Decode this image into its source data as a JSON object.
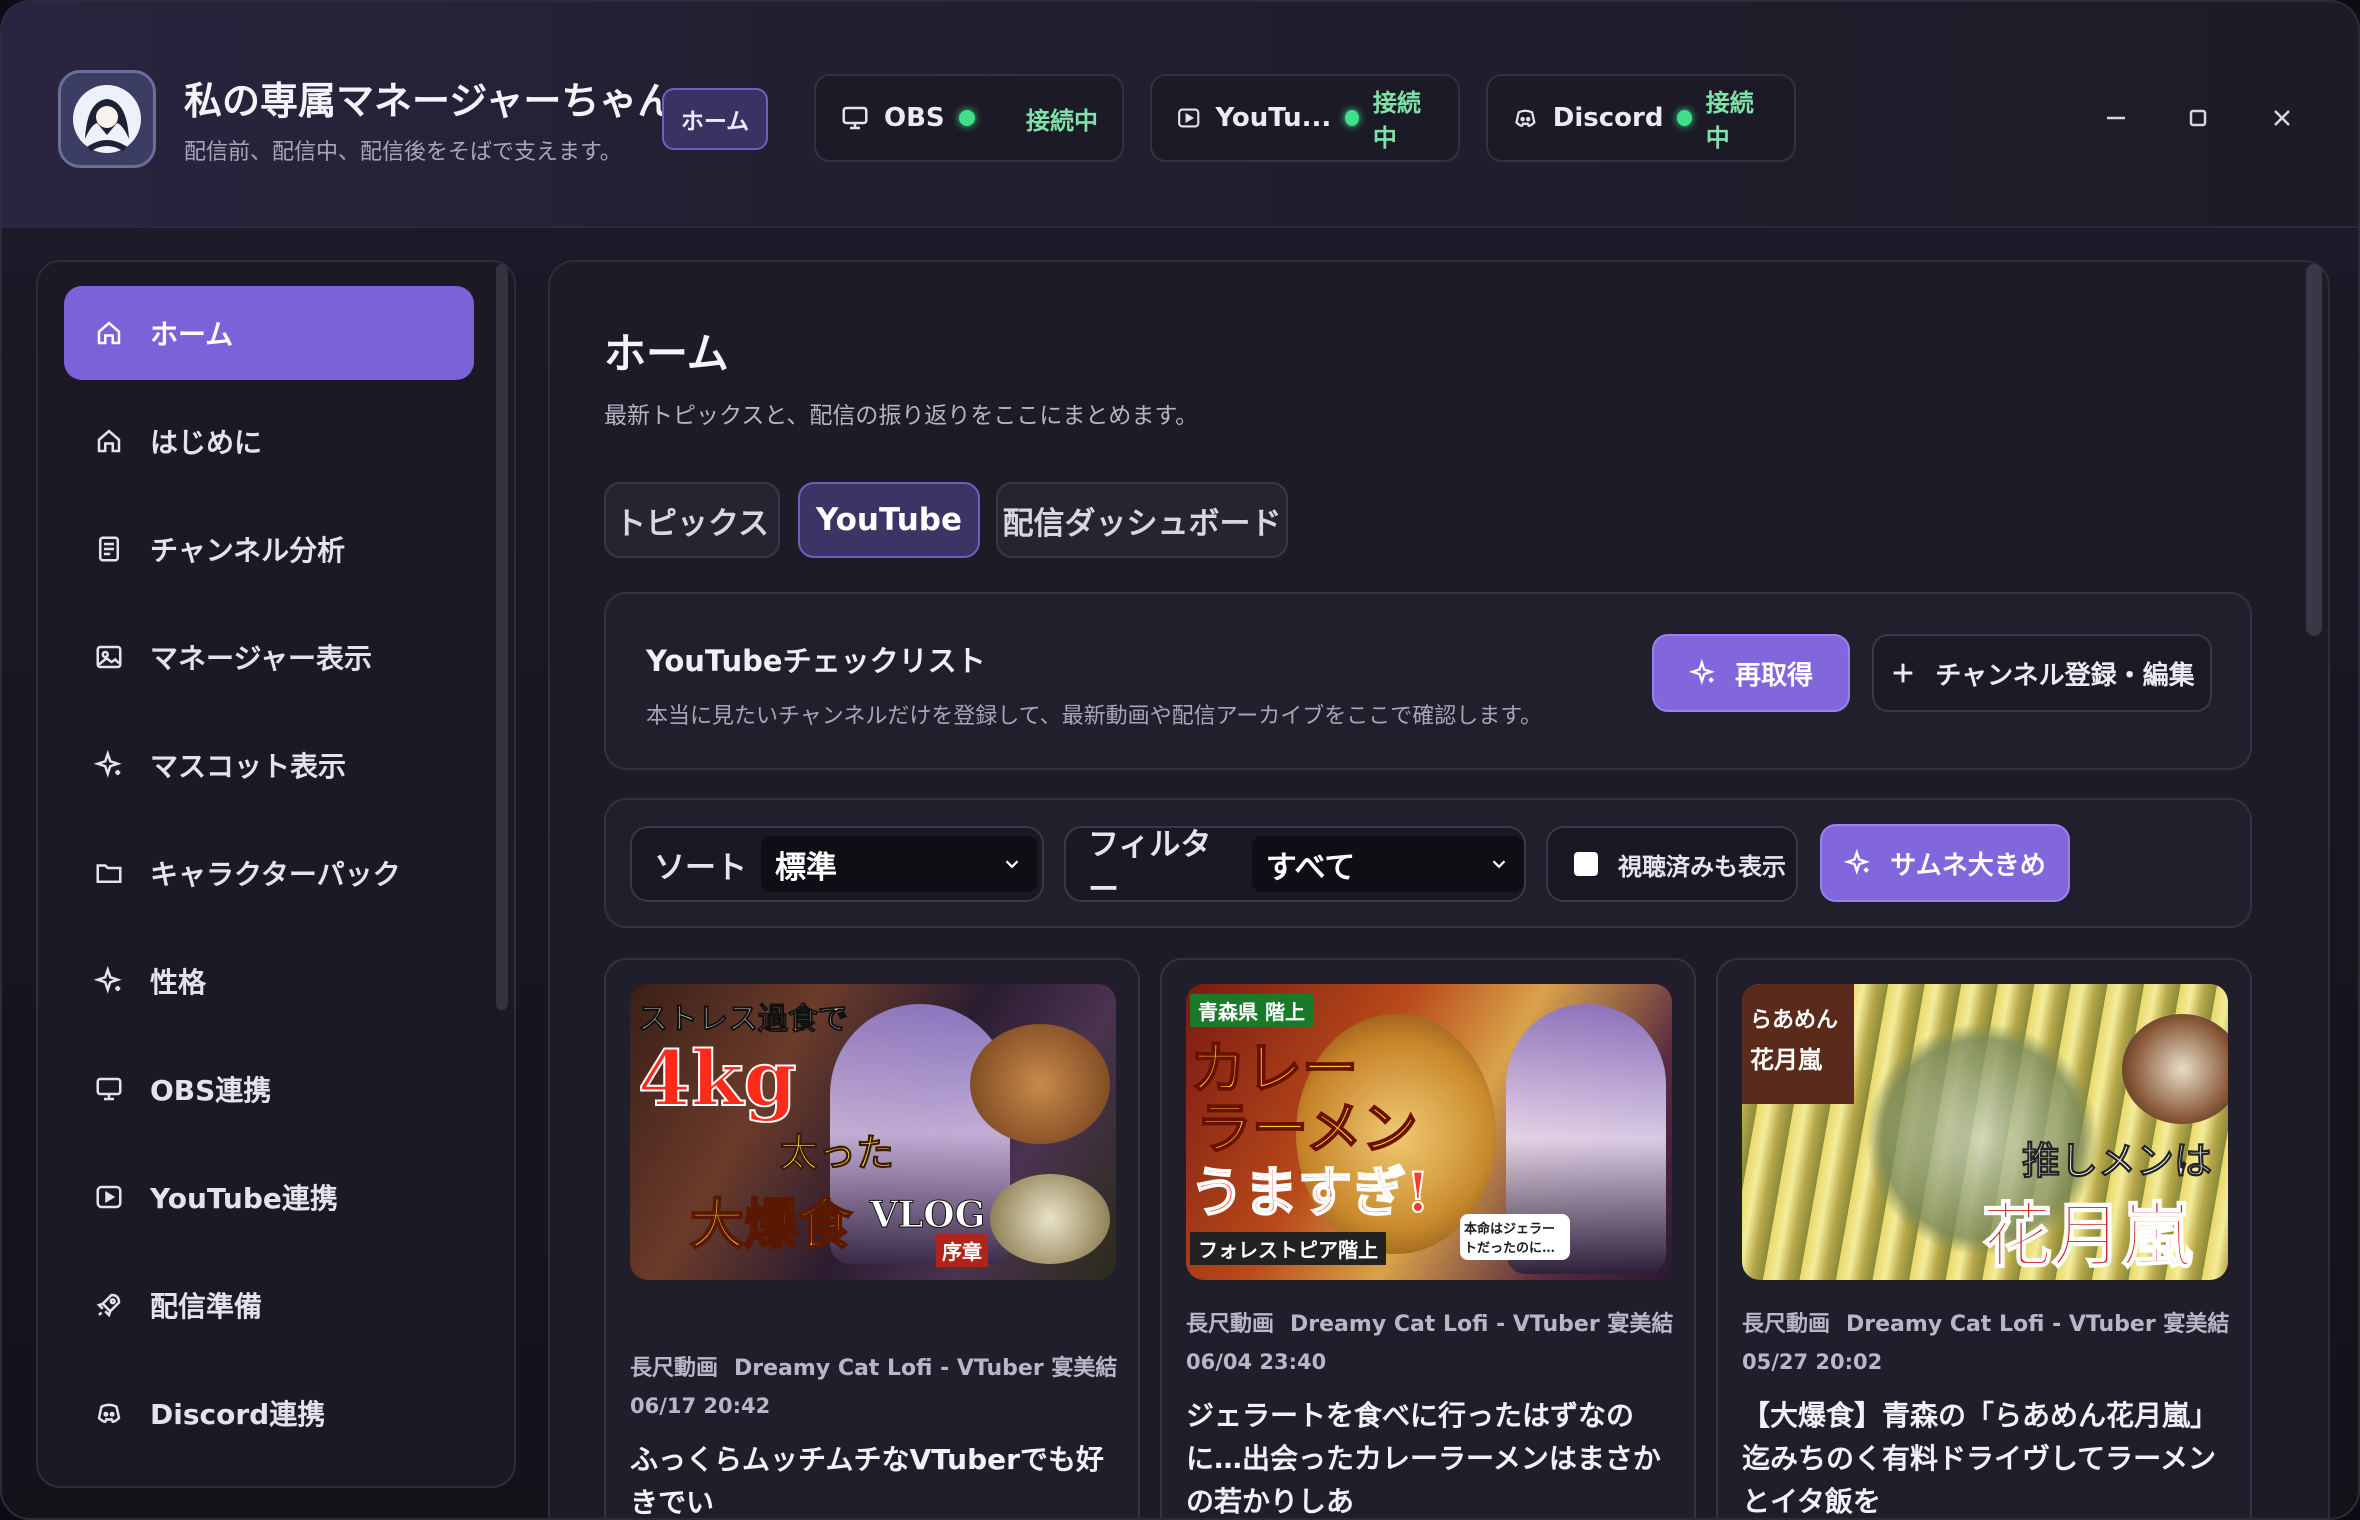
{
  "app": {
    "title": "私の専属マネージャーちゃん",
    "subtitle": "配信前、配信中、配信後をそばで支えます。",
    "home_chip": "ホーム"
  },
  "status": [
    {
      "label": "OBS",
      "state": "接続中",
      "icon": "monitor-icon"
    },
    {
      "label": "YouTu...",
      "state": "接続中",
      "icon": "play-icon"
    },
    {
      "label": "Discord",
      "state": "接続中",
      "icon": "discord-icon"
    }
  ],
  "sidebar": {
    "items": [
      {
        "label": "ホーム",
        "icon": "home-icon",
        "active": true
      },
      {
        "label": "はじめに",
        "icon": "home-outline-icon"
      },
      {
        "label": "チャンネル分析",
        "icon": "document-icon"
      },
      {
        "label": "マネージャー表示",
        "icon": "image-icon"
      },
      {
        "label": "マスコット表示",
        "icon": "sparkle-icon"
      },
      {
        "label": "キャラクターパック",
        "icon": "folder-icon"
      },
      {
        "label": "性格",
        "icon": "sparkle-icon"
      },
      {
        "label": "OBS連携",
        "icon": "monitor-icon"
      },
      {
        "label": "YouTube連携",
        "icon": "play-icon"
      },
      {
        "label": "配信準備",
        "icon": "rocket-icon"
      },
      {
        "label": "Discord連携",
        "icon": "discord-icon"
      }
    ]
  },
  "main": {
    "title": "ホーム",
    "description": "最新トピックスと、配信の振り返りをここにまとめます。",
    "tabs": [
      {
        "label": "トピックス"
      },
      {
        "label": "YouTube",
        "active": true
      },
      {
        "label": "配信ダッシュボード"
      }
    ],
    "checklist": {
      "title": "YouTubeチェックリスト",
      "description": "本当に見たいチャンネルだけを登録して、最新動画や配信アーカイブをここで確認します。",
      "refresh_label": "再取得",
      "edit_label": "チャンネル登録・編集"
    },
    "filters": {
      "sort_label": "ソート",
      "sort_value": "標準",
      "filter_label": "フィルター",
      "filter_value": "すべて",
      "show_watched_label": "視聴済みも表示",
      "large_thumb_label": "サムネ大きめ"
    },
    "videos": [
      {
        "type": "長尺動画",
        "channel": "Dreamy Cat Lofi - VTuber 宴美結",
        "date": "06/17 20:42",
        "title": "ふっくらムッチムチなVTuberでも好きでい",
        "thumb_lines": [
          "ストレス過食で",
          "4kg",
          "太った",
          "大爆食",
          "VLOG",
          "序章"
        ]
      },
      {
        "type": "長尺動画",
        "channel": "Dreamy Cat Lofi - VTuber 宴美結",
        "date": "06/04 23:40",
        "title": "ジェラートを食べに行ったはずなのに…出会ったカレーラーメンはまさかの若かりしあ",
        "thumb_lines": [
          "青森県 階上",
          "カレー",
          "ラーメン",
          "うますぎ!",
          "フォレストピア階上",
          "本命はジェラートだったのに…"
        ]
      },
      {
        "type": "長尺動画",
        "channel": "Dreamy Cat Lofi - VTuber 宴美結",
        "date": "05/27 20:02",
        "title": "【大爆食】青森の「らあめん花月嵐」迄みちのく有料ドライヴしてラーメンとイタ飯を",
        "thumb_lines": [
          "らあめん",
          "花月嵐",
          "推しメンは",
          "花月嵐"
        ]
      }
    ]
  }
}
